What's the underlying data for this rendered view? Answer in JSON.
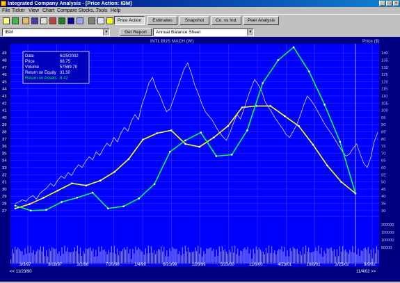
{
  "window": {
    "title": "Integrated Company Analysis - [Price Action:  IBM]"
  },
  "menu": [
    "File",
    "Ticker",
    "View",
    "Chart",
    "Compare Stocks...",
    "Tools",
    "Help"
  ],
  "tabs": [
    {
      "label": "Price Action",
      "active": true
    },
    {
      "label": "Estimates",
      "active": false
    },
    {
      "label": "Snapshot",
      "active": false
    },
    {
      "label": "Co. vs Ind.",
      "active": false
    },
    {
      "label": "Peer Analysis",
      "active": false
    }
  ],
  "selectors": {
    "ticker": "IBM",
    "get_report_label": "Get Report",
    "report_type": "Annual Balance Sheet"
  },
  "chart_header": {
    "left": "INTL BUS MACH (W)",
    "right": "Price ($)"
  },
  "colors": {
    "plot_bg": "#0000ff",
    "price_line": "#c8c8e8",
    "equity_line": "#ffff00",
    "assets_line": "#00ff40",
    "volume_bar": "#8080ff"
  },
  "info_box": {
    "rows": [
      {
        "label": "Date",
        "value": "6/25/2002",
        "color": "#ffffff"
      },
      {
        "label": "Price",
        "value": "68.75",
        "color": "#ffffff"
      },
      {
        "label": "Volume",
        "value": "57589.70",
        "color": "#ffffff"
      },
      {
        "label": "Return on Equity",
        "value": "31.50",
        "color": "#ffff00"
      },
      {
        "label": "Return on Assets",
        "value": "8.42",
        "color": "#00ff40"
      }
    ]
  },
  "nav": {
    "left": "<< 11/23/90",
    "right": "11/4/02 >>"
  },
  "chart_data": {
    "type": "line",
    "x_tick_labels": [
      "3/3/97",
      "8/18/97",
      "2/2/98",
      "7/20/98",
      "1/4/99",
      "6/21/99",
      "12/6/99",
      "5/22/00",
      "11/6/00",
      "4/23/01",
      "10/8/01",
      "3/25/02",
      "9/9/02"
    ],
    "left_axis": {
      "ticks": [
        27,
        28,
        29,
        30,
        31,
        32,
        33,
        34,
        35,
        36,
        37,
        38,
        39,
        40,
        41,
        42,
        43,
        44,
        45,
        46,
        47,
        48,
        49
      ]
    },
    "right_axis": {
      "label": "Price ($)",
      "ticks": [
        30,
        35,
        40,
        45,
        50,
        55,
        60,
        65,
        70,
        75,
        80,
        85,
        90,
        95,
        100,
        105,
        110,
        115,
        120,
        125,
        130,
        135,
        140
      ],
      "ylim": [
        25,
        145
      ]
    },
    "volume_axis": {
      "ticks": [
        "200000",
        "150000",
        "100000",
        "50000"
      ]
    },
    "series": [
      {
        "name": "Return on Equity",
        "color": "#ffff00",
        "x": [
          0,
          0.7,
          1.4,
          2.1,
          2.8,
          3.5,
          4.2,
          4.9,
          5.6,
          6.3,
          7.0,
          7.7,
          8.4,
          9.1,
          9.8,
          10.5,
          11.2,
          11.9
        ],
        "values": [
          27.3,
          27.9,
          28.8,
          29.8,
          30.8,
          30.5,
          31.2,
          32.4,
          34.2,
          36.9,
          37.8,
          38.2,
          36.3,
          35.9,
          37.2,
          38.8,
          41.4,
          41.6
        ]
      },
      {
        "name": "Return on Assets",
        "color": "#00ff40",
        "x": [
          0,
          0.7,
          1.4,
          2.1,
          2.8,
          3.5,
          4.2,
          4.9,
          5.6,
          6.3,
          7.0,
          7.7,
          8.4,
          9.1,
          9.8,
          10.5,
          11.2,
          11.9
        ],
        "values": [
          27.7,
          27.0,
          27.1,
          28.2,
          28.8,
          29.5,
          27.3,
          27.6,
          28.7,
          30.7,
          35.2,
          36.8,
          37.9,
          34.6,
          34.8,
          38.2,
          44.8,
          48.0
        ]
      },
      {
        "name": "Price",
        "color": "#c8c8e8",
        "values": []
      }
    ],
    "equity_tail": [
      41.6,
      40.2,
      38.8,
      36.2,
      33.3,
      31.0,
      29.4
    ],
    "assets_tail": [
      49.8,
      46.4,
      41.8,
      36.6,
      29.4
    ],
    "price_points": [
      28,
      28.2,
      28.5,
      28.3,
      28.8,
      29.1,
      28.6,
      29.4,
      29.8,
      30.2,
      30.8,
      30.4,
      31.2,
      31.8,
      31.5,
      32.3,
      31.9,
      32.8,
      33.4,
      33.0,
      33.9,
      34.5,
      34.1,
      35.2,
      34.7,
      35.6,
      36.4,
      36.0,
      37.2,
      36.6,
      37.8,
      38.6,
      38.1,
      39.5,
      40.4,
      39.7,
      41.8,
      43.2,
      44.8,
      45.6,
      44.1,
      43.2,
      41.9,
      40.8,
      41.2,
      42.6,
      44.0,
      45.4,
      46.8,
      47.6,
      46.2,
      44.5,
      43.3,
      41.9,
      40.8,
      40.2,
      39.6,
      38.7,
      37.9,
      37.3,
      36.8,
      37.9,
      39.2,
      40.4,
      39.8,
      41.2,
      42.7,
      44.1,
      45.3,
      44.6,
      43.7,
      42.2,
      41.4,
      40.6,
      39.8,
      39.1,
      38.4,
      37.6,
      37.2,
      38.1,
      39.0,
      40.3,
      41.8,
      43.0,
      42.4,
      41.7,
      40.8,
      39.9,
      39.0,
      38.3,
      37.6,
      36.8,
      36.0,
      35.2,
      34.6,
      34.9,
      35.7,
      36.3,
      34.9,
      33.6,
      33.0,
      34.4,
      36.6,
      37.9
    ]
  }
}
